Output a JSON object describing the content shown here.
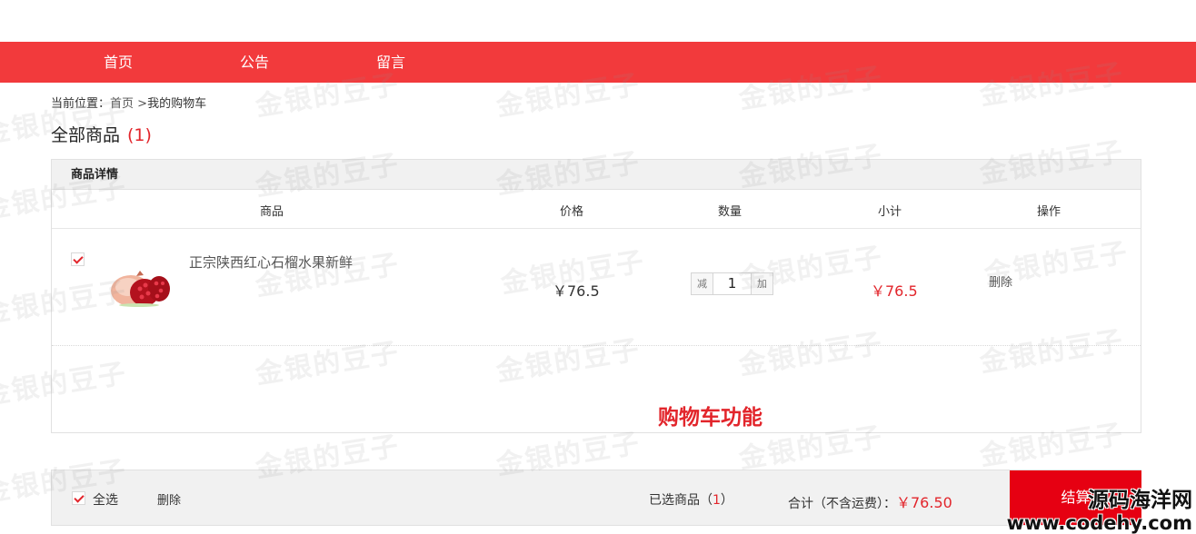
{
  "nav": {
    "items": [
      {
        "label": "首页"
      },
      {
        "label": "公告"
      },
      {
        "label": "留言"
      }
    ]
  },
  "breadcrumb": {
    "prefix": "当前位置：",
    "home": "首页",
    "separator": ">",
    "current": "我的购物车"
  },
  "cart": {
    "title": "全部商品",
    "count": "(1)",
    "section_header": "商品详情",
    "columns": [
      "商品",
      "价格",
      "数量",
      "小计",
      "操作"
    ],
    "items": [
      {
        "checked": true,
        "name": "正宗陕西红心石榴水果新鲜",
        "price": "￥76.5",
        "qty_minus": "减",
        "quantity": "1",
        "qty_plus": "加",
        "subtotal": "￥76.5",
        "delete_label": "删除",
        "image_icon": "pomegranate-image"
      }
    ],
    "overlay_label": "购物车功能"
  },
  "footer": {
    "select_all": "全选",
    "delete_label": "删除",
    "selected_prefix": "已选商品（",
    "selected_count": "1",
    "selected_suffix": "）",
    "total_label": "合计（不含运费）：",
    "total_amount": "￥76.50",
    "checkout_label": "结算"
  },
  "watermark": {
    "text": "金银的豆子"
  },
  "site_watermark": {
    "name": "源码海洋网",
    "url": "www.codehy.com"
  },
  "colors": {
    "nav_bg": "#f23a3c",
    "accent": "#e2252b",
    "checkout_bg": "#e60012"
  }
}
